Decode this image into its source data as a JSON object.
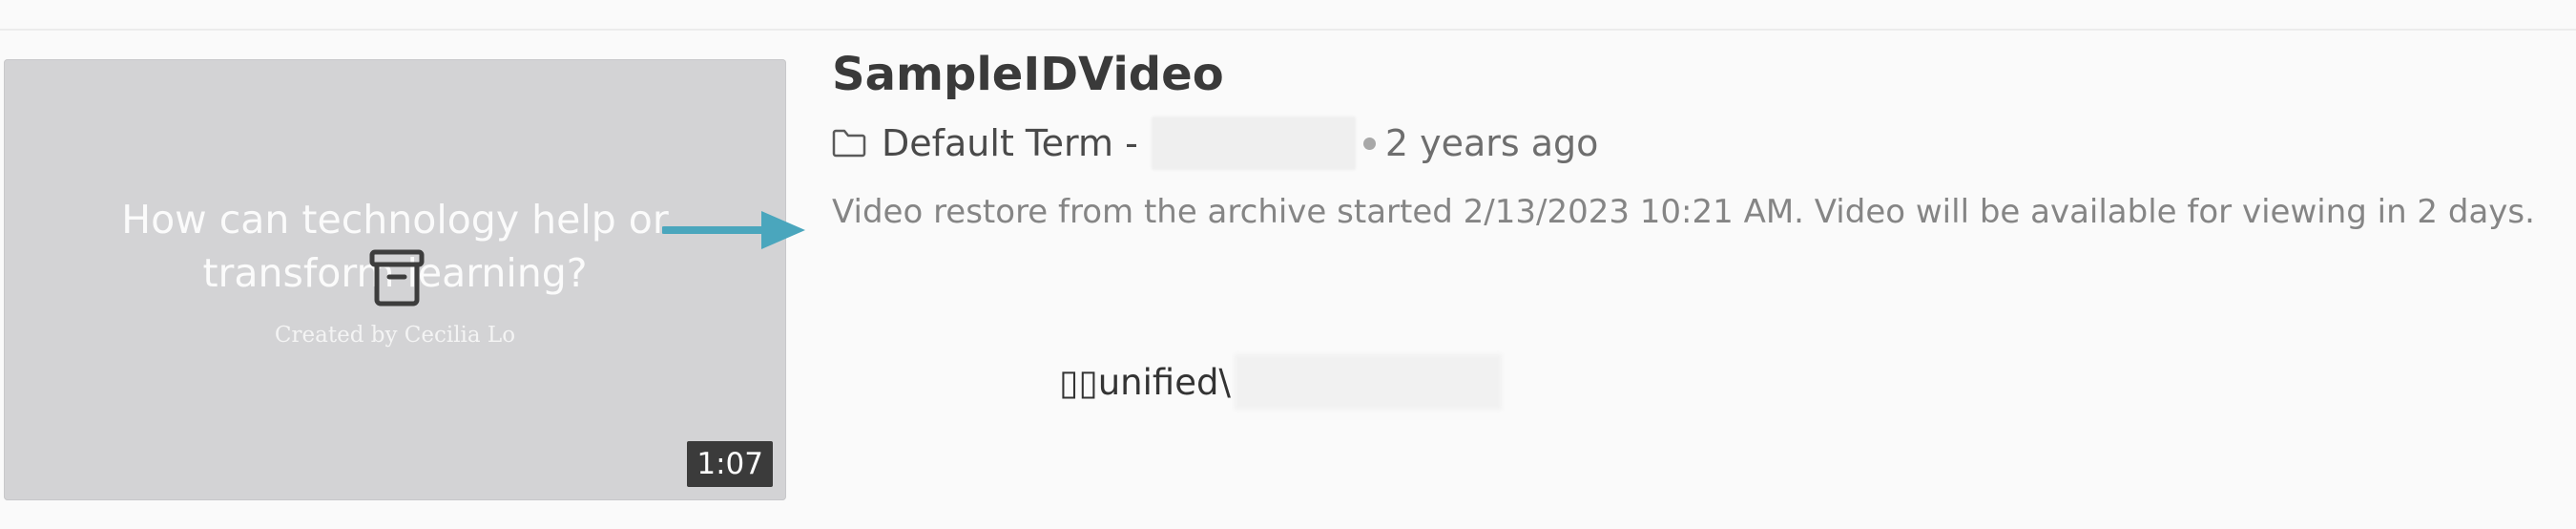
{
  "video": {
    "title": "SampleIDVideo",
    "folder": "Default Term -",
    "time_ago": "2 years ago",
    "status_message": "Video restore from the archive started 2/13/2023 10:21 AM. Video will be available for viewing in 2 days.",
    "duration": "1:07",
    "thumbnail": {
      "title": "How can technology help or\ntransform learning?",
      "credit": "Created by Cecilia Lo"
    },
    "path": "▯▯unified\\"
  },
  "colors": {
    "arrow": "#4aa6bd",
    "thumbnail_bg": "#d3d3d5",
    "title_text": "#3a3a3a",
    "muted_text": "#858585"
  },
  "icons": {
    "archive": "archive-box-icon",
    "folder": "folder-icon",
    "arrow": "arrow-right-icon"
  }
}
